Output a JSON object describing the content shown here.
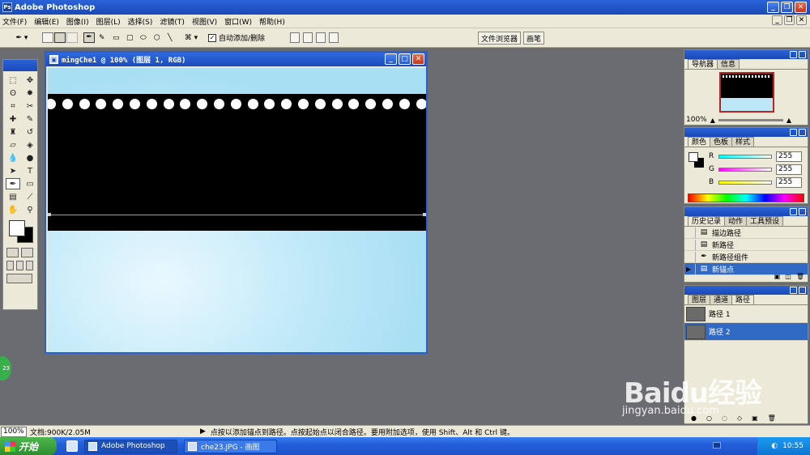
{
  "window": {
    "title": "Adobe Photoshop",
    "icon_text": "Ps"
  },
  "menu": [
    "文件(F)",
    "编辑(E)",
    "图像(I)",
    "图层(L)",
    "选择(S)",
    "滤镜(T)",
    "视图(V)",
    "窗口(W)",
    "帮助(H)"
  ],
  "options": {
    "auto_add_delete": "自动添加/删除",
    "file_browser": "文件浏览器",
    "brushes": "画笔"
  },
  "document": {
    "title": "mingChe1 @ 100% (图层 1, RGB)"
  },
  "navigator": {
    "tabs": [
      "导航器",
      "信息"
    ],
    "zoom": "100%"
  },
  "color": {
    "tabs": [
      "颜色",
      "色板",
      "样式"
    ],
    "channels": [
      {
        "label": "R",
        "value": "255"
      },
      {
        "label": "G",
        "value": "255"
      },
      {
        "label": "B",
        "value": "255"
      }
    ]
  },
  "history": {
    "tabs": [
      "历史记录",
      "动作",
      "工具预设"
    ],
    "items": [
      "描边路径",
      "新路径",
      "新路径组件",
      "新锚点"
    ],
    "selected_index": 3
  },
  "paths": {
    "tabs": [
      "图层",
      "通道",
      "路径"
    ],
    "items": [
      "路径 1",
      "路径 2"
    ],
    "selected_index": 1
  },
  "status": {
    "zoom": "100%",
    "doc": "文档:900K/2.05M",
    "hint": "点按以添加锚点到路径。点按起始点以闭合路径。要用附加选项，使用 Shift、Alt 和 Ctrl 键。"
  },
  "taskbar": {
    "start": "开始",
    "tasks": [
      "Adobe Photoshop",
      "che23.JPG - 画图"
    ],
    "clock": "10:55"
  },
  "decorations": {
    "badge": "23",
    "watermark": "Baidu经验",
    "watermark_url": "jingyan.baidu.com"
  }
}
